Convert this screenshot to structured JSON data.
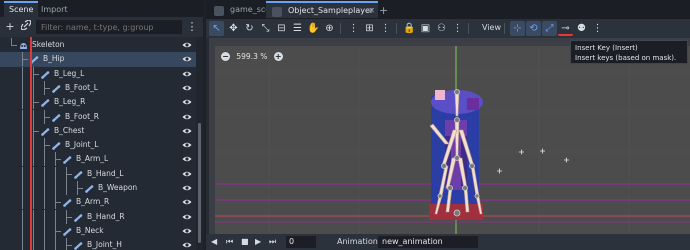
{
  "dock": {
    "tabs": [
      {
        "label": "Scene"
      },
      {
        "label": "Import"
      }
    ],
    "filter_placeholder": "Filter: name, t:type, g:group",
    "tree": [
      {
        "label": "Skeleton",
        "depth": 1,
        "icon": "skeleton-icon"
      },
      {
        "label": "B_Hip",
        "depth": 2,
        "icon": "bone-icon",
        "selected": true
      },
      {
        "label": "B_Leg_L",
        "depth": 3,
        "icon": "bone-icon"
      },
      {
        "label": "B_Foot_L",
        "depth": 4,
        "icon": "bone-icon"
      },
      {
        "label": "B_Leg_R",
        "depth": 3,
        "icon": "bone-icon"
      },
      {
        "label": "B_Foot_R",
        "depth": 4,
        "icon": "bone-icon"
      },
      {
        "label": "B_Chest",
        "depth": 3,
        "icon": "bone-icon"
      },
      {
        "label": "B_Joint_L",
        "depth": 4,
        "icon": "bone-icon"
      },
      {
        "label": "B_Arm_L",
        "depth": 5,
        "icon": "bone-icon"
      },
      {
        "label": "B_Hand_L",
        "depth": 6,
        "icon": "bone-icon"
      },
      {
        "label": "B_Weapon",
        "depth": 7,
        "icon": "bone-icon"
      },
      {
        "label": "B_Arm_R",
        "depth": 5,
        "icon": "bone-icon"
      },
      {
        "label": "B_Hand_R",
        "depth": 6,
        "icon": "bone-icon"
      },
      {
        "label": "B_Neck",
        "depth": 5,
        "icon": "bone-icon"
      },
      {
        "label": "B_Joint_H",
        "depth": 6,
        "icon": "bone-icon"
      }
    ]
  },
  "main": {
    "scene_tabs": [
      {
        "label": "game_scene",
        "active": false
      },
      {
        "label": "Object_Sampleplayer",
        "active": true
      }
    ],
    "add_tab": "+",
    "toolbar": {
      "view_label": "View",
      "more": "⋮"
    },
    "viewport": {
      "zoom_minus": "−",
      "zoom_level": "599.3 %",
      "zoom_plus": "+"
    },
    "tooltip": {
      "line1": "Insert Key (Insert)",
      "line2": "Insert keys (based on mask)."
    },
    "bottom": {
      "frame_value": "0",
      "animation_label": "Animation",
      "animation_value": "new_animation"
    }
  },
  "colors": {
    "accent": "#6aa3f4",
    "selection": "#37475d",
    "red_guide": "#e23a3a",
    "magenta_guide": "#9a2ba0",
    "green_axis": "#7ecb60"
  }
}
